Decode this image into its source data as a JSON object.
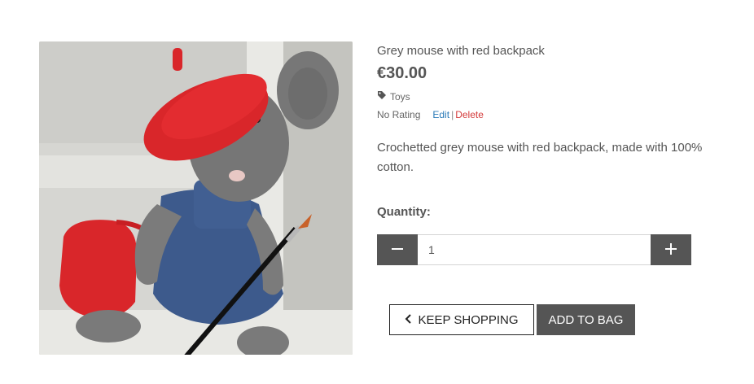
{
  "product": {
    "image_alt": "Grey mouse with red backpack",
    "title": "Grey mouse with red backpack",
    "price": "€30.00",
    "category_icon": "tag-icon",
    "category": "Toys",
    "rating": "No Rating",
    "edit_label": "Edit",
    "separator": "|",
    "delete_label": "Delete",
    "description": "Crochetted grey mouse with red backpack, made with 100% cotton."
  },
  "quantity": {
    "label": "Quantity:",
    "decrement_icon": "minus-icon",
    "increment_icon": "plus-icon",
    "value": "1"
  },
  "actions": {
    "keep_shopping_icon": "chevron-left-icon",
    "keep_shopping_label": "Keep Shopping",
    "add_to_bag_label": "Add to Bag"
  },
  "colors": {
    "primary_button": "#555555",
    "edit_link": "#2a7ab8",
    "delete_link": "#d43b3b"
  }
}
